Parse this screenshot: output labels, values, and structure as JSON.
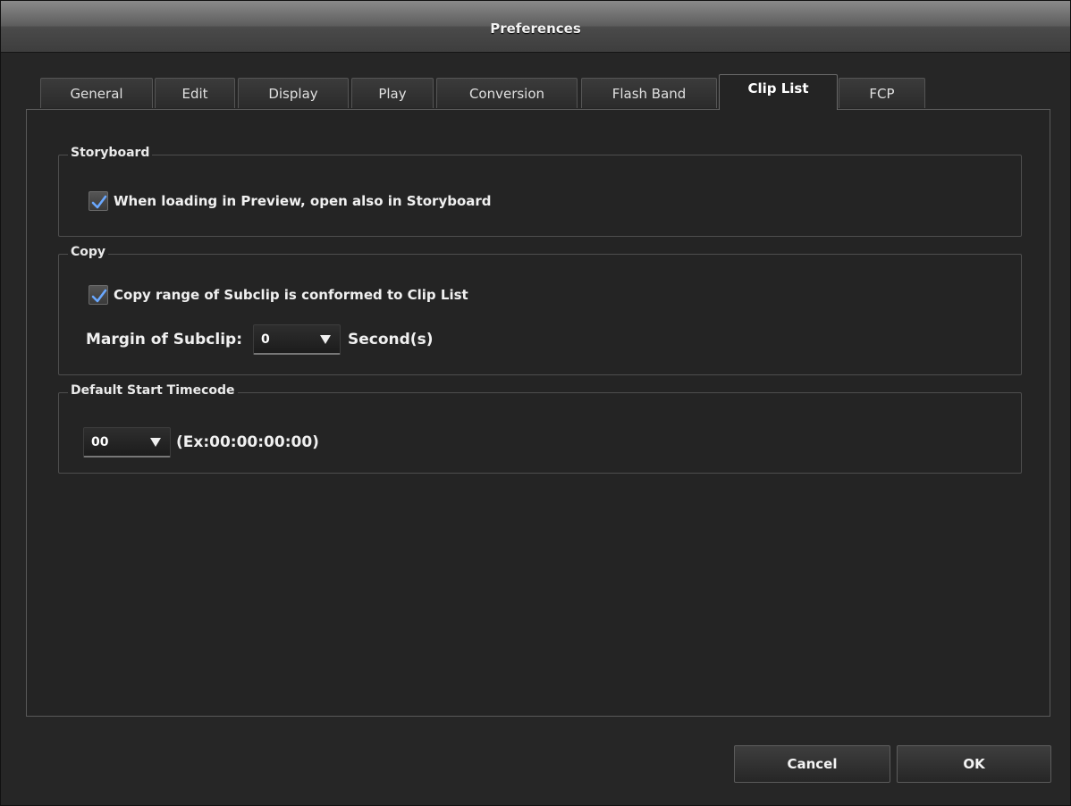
{
  "window": {
    "title": "Preferences"
  },
  "tabs": [
    {
      "label": "General"
    },
    {
      "label": "Edit"
    },
    {
      "label": "Display"
    },
    {
      "label": "Play"
    },
    {
      "label": "Conversion"
    },
    {
      "label": "Flash Band"
    },
    {
      "label": "Clip List",
      "active": true
    },
    {
      "label": "FCP"
    }
  ],
  "storyboard": {
    "title": "Storyboard",
    "checkbox_label": "When loading in Preview, open also in Storyboard",
    "checked": true
  },
  "copy": {
    "title": "Copy",
    "checkbox_label": "Copy range of Subclip is conformed to Clip List",
    "checked": true,
    "margin_label": "Margin of Subclip:",
    "margin_value": "0",
    "margin_unit": "Second(s)"
  },
  "timecode": {
    "title": "Default Start Timecode",
    "value": "00",
    "example": "(Ex:00:00:00:00)"
  },
  "buttons": {
    "cancel": "Cancel",
    "ok": "OK"
  },
  "colors": {
    "check_accent": "#6aa8ff",
    "background": "#262626"
  },
  "icons": {
    "checkmark": "check-icon",
    "dropdown": "chevron-down-icon"
  }
}
